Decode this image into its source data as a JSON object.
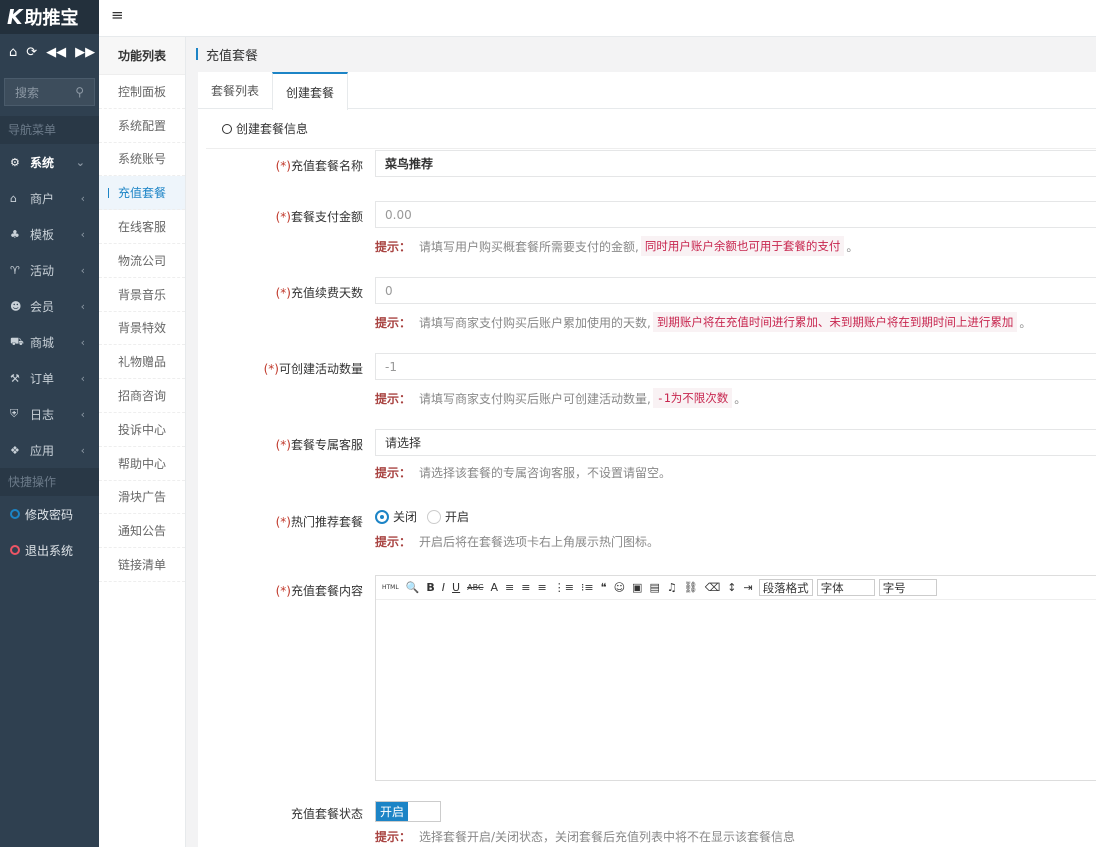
{
  "brand": {
    "logo": "K",
    "name": "助推宝"
  },
  "sidebar": {
    "search_placeholder": "搜索",
    "nav_group": "导航菜单",
    "items": [
      {
        "label": "系统",
        "icon": "gear-icon",
        "glyph": "⚙"
      },
      {
        "label": "商户",
        "icon": "home-icon",
        "glyph": "⌂"
      },
      {
        "label": "模板",
        "icon": "sitemap-icon",
        "glyph": "♣"
      },
      {
        "label": "活动",
        "icon": "trophy-icon",
        "glyph": "♈"
      },
      {
        "label": "会员",
        "icon": "users-icon",
        "glyph": "☻"
      },
      {
        "label": "商城",
        "icon": "cart-icon",
        "glyph": "⛟"
      },
      {
        "label": "订单",
        "icon": "gavel-icon",
        "glyph": "⚒"
      },
      {
        "label": "日志",
        "icon": "shield-icon",
        "glyph": "⛨"
      },
      {
        "label": "应用",
        "icon": "cubes-icon",
        "glyph": "❖"
      }
    ],
    "quick_group": "快捷操作",
    "quick": [
      {
        "label": "修改密码",
        "color": "#1c84c6"
      },
      {
        "label": "退出系统",
        "color": "#ed5565"
      }
    ]
  },
  "submenu": {
    "title": "功能列表",
    "items": [
      "控制面板",
      "系统配置",
      "系统账号",
      "充值套餐",
      "在线客服",
      "物流公司",
      "背景音乐",
      "背景特效",
      "礼物赠品",
      "招商咨询",
      "投诉中心",
      "帮助中心",
      "滑块广告",
      "通知公告",
      "链接清单"
    ]
  },
  "breadcrumb": "充值套餐",
  "tabs": [
    "套餐列表",
    "创建套餐"
  ],
  "section": "创建套餐信息",
  "form": {
    "req": "(*)",
    "tip": "提示：",
    "name": {
      "label": "充值套餐名称",
      "value": "菜鸟推荐"
    },
    "price": {
      "label": "套餐支付金额",
      "placeholder": "0.00",
      "hint": "请填写用户购买概套餐所需要支付的金额,",
      "hint_code": "同时用户账户余额也可用于套餐的支付",
      "hint_end": "。"
    },
    "days": {
      "label": "充值续费天数",
      "placeholder": "0",
      "hint": "请填写商家支付购买后账户累加使用的天数,",
      "hint_code": "到期账户将在充值时间进行累加、未到期账户将在到期时间上进行累加",
      "hint_end": "。"
    },
    "activities": {
      "label": "可创建活动数量",
      "placeholder": "-1",
      "hint": "请填写商家支付购买后账户可创建活动数量,",
      "hint_code": "-1为不限次数",
      "hint_end": "。"
    },
    "service": {
      "label": "套餐专属客服",
      "value": "请选择",
      "hint": "请选择该套餐的专属咨询客服，不设置请留空。"
    },
    "hot": {
      "label": "热门推荐套餐",
      "options": [
        "关闭",
        "开启"
      ],
      "selected": "关闭",
      "hint": "开启后将在套餐选项卡右上角展示热门图标。"
    },
    "content": {
      "label": "充值套餐内容",
      "toolbar": {
        "html": "HTML",
        "bold": "B",
        "italic": "I",
        "underline": "U",
        "strike": "ABC",
        "font_color": "A",
        "para": "段落格式",
        "font": "字体",
        "size": "字号"
      }
    },
    "status": {
      "label": "充值套餐状态",
      "toggle": "开启",
      "hint": "选择套餐开启/关闭状态，关闭套餐后充值列表中将不在显示该套餐信息"
    }
  }
}
